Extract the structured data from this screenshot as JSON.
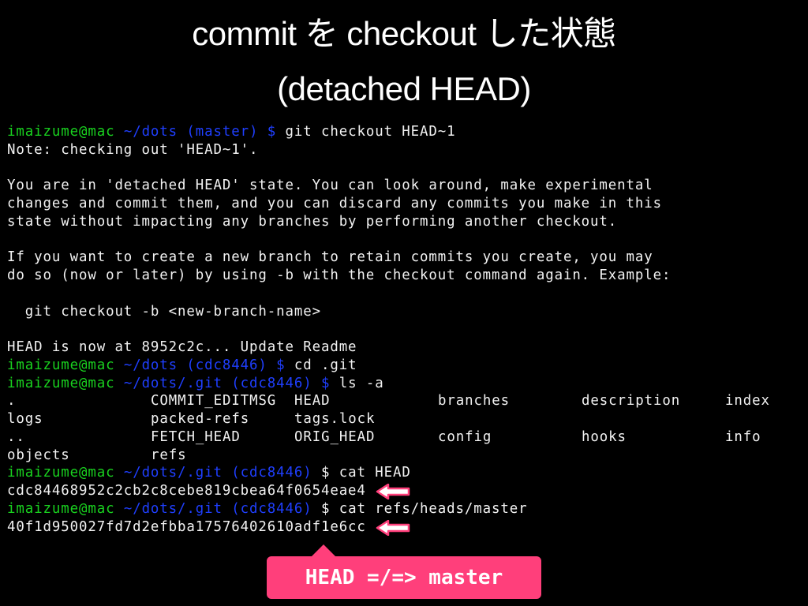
{
  "slide": {
    "title_line1": "commit を checkout した状態",
    "title_line2": "(detached HEAD)"
  },
  "colors": {
    "prompt_user": "#19d11f",
    "prompt_path": "#1f3fff",
    "text": "#f2f2f2",
    "accent": "#ff3f7b",
    "background": "#000000"
  },
  "terminal": {
    "prompt1": {
      "user": "imaizume@mac",
      "path": " ~/dots (master) $",
      "command": " git checkout HEAD~1"
    },
    "output1": [
      "Note: checking out 'HEAD~1'.",
      "",
      "You are in 'detached HEAD' state. You can look around, make experimental",
      "changes and commit them, and you can discard any commits you make in this",
      "state without impacting any branches by performing another checkout.",
      "",
      "If you want to create a new branch to retain commits you create, you may",
      "do so (now or later) by using -b with the checkout command again. Example:",
      "",
      "  git checkout -b <new-branch-name>",
      "",
      "HEAD is now at 8952c2c... Update Readme"
    ],
    "prompt2": {
      "user": "imaizume@mac",
      "path": " ~/dots (cdc8446) $",
      "command": " cd .git"
    },
    "prompt3": {
      "user": "imaizume@mac",
      "path": " ~/dots/.git (cdc8446) $",
      "command": " ls -a"
    },
    "ls_rows": [
      [
        ".",
        "COMMIT_EDITMSG",
        "HEAD",
        "branches",
        "description",
        "index"
      ],
      [
        "logs",
        "packed-refs",
        "tags.lock",
        "",
        "",
        ""
      ],
      [
        "..",
        "FETCH_HEAD",
        "ORIG_HEAD",
        "config",
        "hooks",
        "info"
      ],
      [
        "objects",
        "refs",
        "",
        "",
        "",
        ""
      ]
    ],
    "prompt4": {
      "user": "imaizume@mac",
      "path": " ~/dots/.git (cdc8446)",
      "dollar": " $",
      "command": " cat HEAD"
    },
    "head_hash": "cdc84468952c2cb2c8cebe819cbea64f0654eae4",
    "prompt5": {
      "user": "imaizume@mac",
      "path": " ~/dots/.git (cdc8446)",
      "dollar": " $",
      "command": " cat refs/heads/master"
    },
    "master_hash": "40f1d950027fd7d2efbba17576402610adf1e6cc"
  },
  "annotations": {
    "arrow_icon": "left-arrow-icon",
    "callout_text": "HEAD =/=> master"
  }
}
